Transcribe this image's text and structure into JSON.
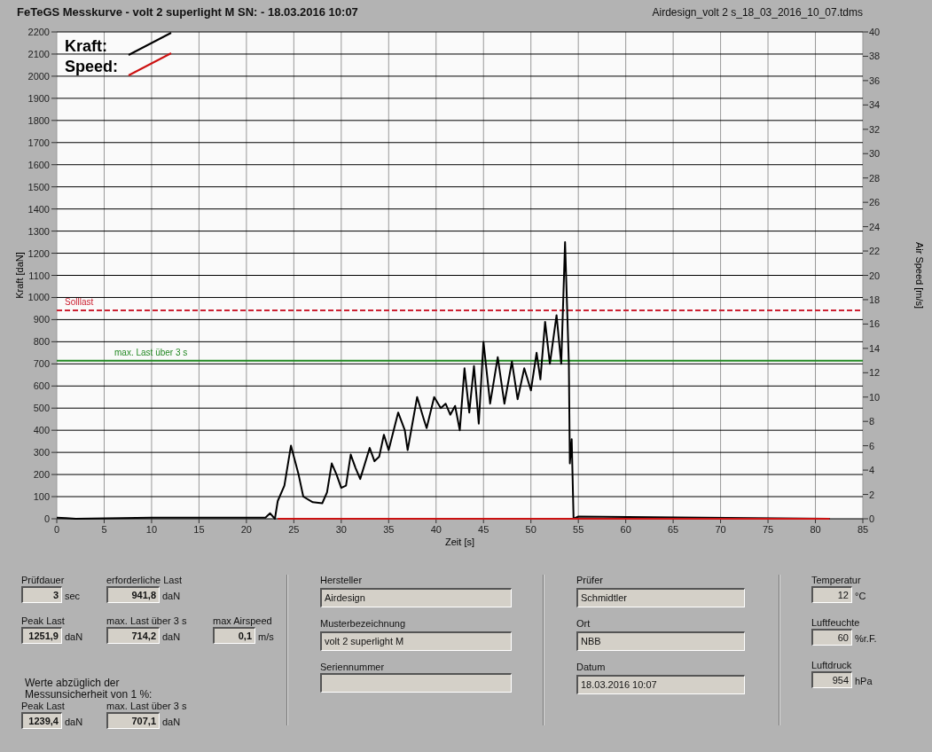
{
  "header": {
    "title": "FeTeGS Messkurve - volt 2 superlight M  SN:  - 18.03.2016 10:07",
    "file": "Airdesign_volt 2 s_18_03_2016_10_07.tdms"
  },
  "chart": {
    "chart_data": {
      "type": "line",
      "grid": true,
      "legend": "upper left",
      "xlabel": "Zeit [s]",
      "ylabel": "Kraft [daN]",
      "y2label": "Air Speed [m/s]",
      "x": [
        0,
        1,
        2,
        10,
        20,
        22,
        22.5,
        23,
        23.3,
        24,
        24.7,
        25.5,
        26,
        27,
        28,
        28.5,
        29,
        29.5,
        30,
        30.5,
        31,
        31.5,
        32,
        33,
        33.5,
        34,
        34.5,
        35,
        36,
        36.7,
        37,
        38,
        38.7,
        39,
        39.8,
        40.5,
        41,
        41.5,
        42,
        42.5,
        43,
        43.5,
        44,
        44.5,
        45,
        45.7,
        46.5,
        47.2,
        48,
        48.6,
        49.3,
        50,
        50.6,
        51,
        51.5,
        52,
        52.7,
        53.2,
        53.6,
        54,
        54.1,
        54.3,
        54.5,
        55,
        81.5
      ],
      "series": [
        {
          "name": "Kraft:",
          "color": "#000000",
          "values": [
            5,
            3,
            0,
            5,
            5,
            5,
            25,
            0,
            80,
            150,
            330,
            200,
            100,
            75,
            70,
            120,
            250,
            200,
            140,
            150,
            290,
            230,
            180,
            320,
            260,
            280,
            380,
            310,
            480,
            400,
            310,
            550,
            450,
            410,
            550,
            500,
            520,
            470,
            510,
            400,
            680,
            480,
            690,
            430,
            800,
            520,
            730,
            520,
            710,
            540,
            680,
            580,
            750,
            630,
            890,
            700,
            920,
            700,
            1250,
            700,
            250,
            360,
            0,
            10,
            0
          ]
        },
        {
          "name": "Speed:",
          "color": "#cc1111",
          "values": [
            null,
            null,
            null,
            null,
            null,
            null,
            null,
            null,
            0,
            0,
            0,
            0,
            0,
            0,
            0,
            0,
            0,
            0,
            0,
            0,
            0,
            0,
            0,
            0,
            0,
            0,
            0,
            0,
            0,
            0,
            0,
            0,
            0,
            0,
            0,
            0,
            0,
            0,
            0,
            0,
            0,
            0,
            0,
            0,
            0,
            0,
            0,
            0,
            0,
            0,
            0,
            0,
            0,
            0,
            0,
            0,
            0,
            0,
            0,
            0,
            0,
            0,
            0,
            0,
            0
          ]
        }
      ],
      "xlim": [
        0,
        85
      ],
      "ylim": [
        0,
        2200
      ],
      "y2lim": [
        0,
        40
      ],
      "xticks": [
        0,
        5,
        10,
        15,
        20,
        25,
        30,
        35,
        40,
        45,
        50,
        55,
        60,
        65,
        70,
        75,
        80,
        85
      ],
      "yticks": [
        0,
        100,
        200,
        300,
        400,
        500,
        600,
        700,
        800,
        900,
        1000,
        1100,
        1200,
        1300,
        1400,
        1500,
        1600,
        1700,
        1800,
        1900,
        2000,
        2100,
        2200
      ],
      "y2ticks": [
        0,
        2,
        4,
        6,
        8,
        10,
        12,
        14,
        16,
        18,
        20,
        22,
        24,
        26,
        28,
        30,
        32,
        34,
        36,
        38,
        40
      ],
      "ref_lines": [
        {
          "axis": "y",
          "value": 941.8,
          "label": "Solllast",
          "color": "#cc2233"
        },
        {
          "axis": "y",
          "value": 714.2,
          "label": "max. Last über  3 s",
          "color": "#228822"
        }
      ]
    }
  },
  "results": {
    "rows": [
      [
        {
          "label": "Prüfdauer",
          "value": "3",
          "unit": "sec"
        },
        {
          "label": "erforderliche Last",
          "value": "941,8",
          "unit": "daN"
        }
      ],
      [
        {
          "label": "Peak Last",
          "value": "1251,9",
          "unit": "daN"
        },
        {
          "label": "max. Last über  3 s",
          "value": "714,2",
          "unit": "daN"
        },
        {
          "label": "max Airspeed",
          "value": "0,1",
          "unit": "m/s"
        }
      ]
    ],
    "note": "Werte abzüglich der Messunsicherheit von 1  %:",
    "corrected": [
      {
        "label": "Peak Last",
        "value": "1239,4",
        "unit": "daN"
      },
      {
        "label": "max. Last über  3 s",
        "value": "707,1",
        "unit": "daN"
      }
    ]
  },
  "specimen": [
    {
      "label": "Hersteller",
      "value": "Airdesign"
    },
    {
      "label": "Musterbezeichnung",
      "value": "volt 2 superlight M"
    },
    {
      "label": "Seriennummer"
    }
  ],
  "test": [
    {
      "label": "Prüfer",
      "value": "Schmidtler"
    },
    {
      "label": "Ort",
      "value": "NBB"
    },
    {
      "label": "Datum",
      "value": "18.03.2016 10:07"
    }
  ],
  "environment": [
    {
      "label": "Temperatur",
      "value": "12",
      "unit": "°C"
    },
    {
      "label": "Luftfeuchte",
      "value": "60",
      "unit": "%r.F."
    },
    {
      "label": "Luftdruck",
      "value": "954",
      "unit": "hPa"
    }
  ]
}
